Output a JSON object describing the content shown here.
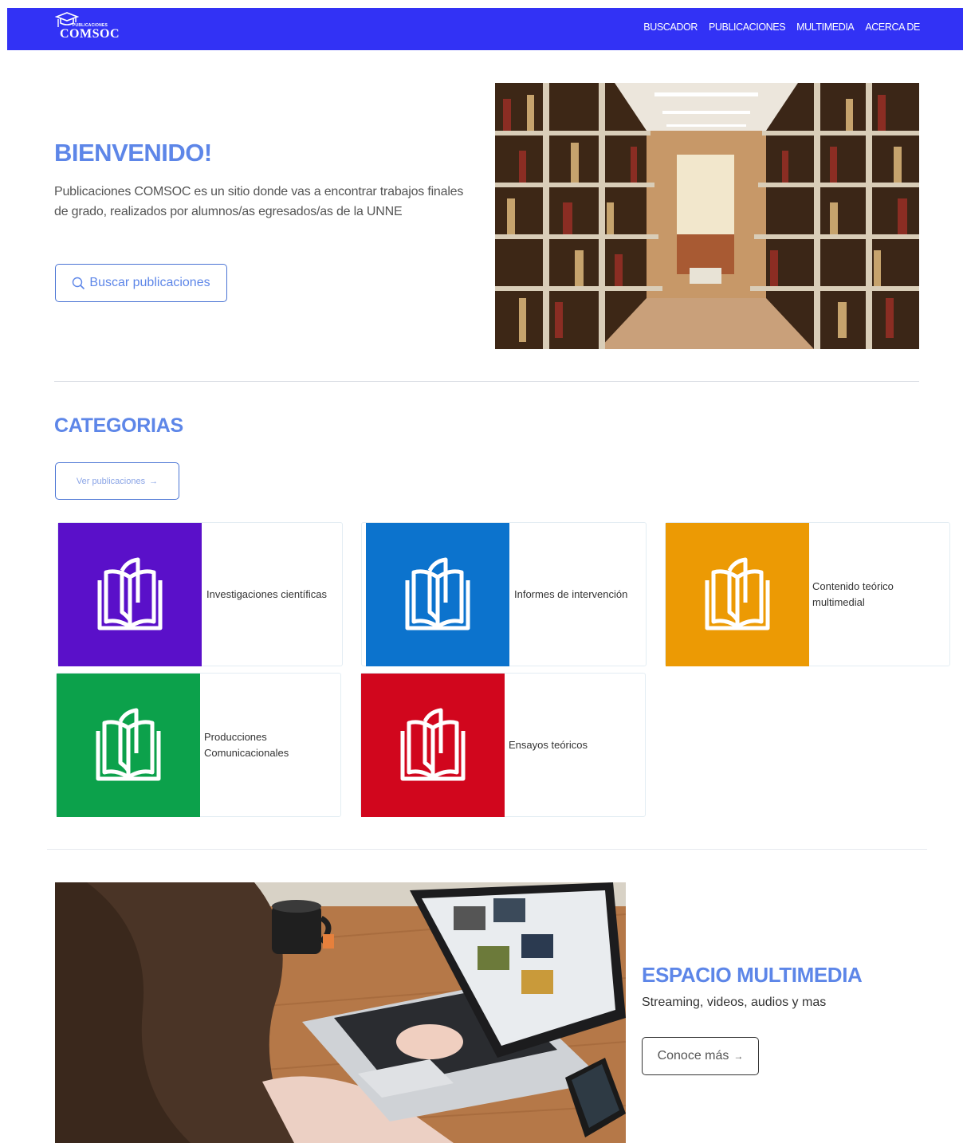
{
  "header": {
    "logo_small": "PUBLICACIONES",
    "logo_big": "COMSOC",
    "nav": [
      "BUSCADOR",
      "PUBLICACIONES",
      "MULTIMEDIA",
      "ACERCA DE"
    ],
    "background": "#3232f5"
  },
  "hero": {
    "title": "BIENVENIDO!",
    "text": "Publicaciones COMSOC es un sitio donde vas a encontrar trabajos finales de grado, realizados por alumnos/as egresados/as de la UNNE",
    "button_label": "Buscar publicaciones",
    "button_icon": "search-icon",
    "image": "library-shelves-photo"
  },
  "categories": {
    "title": "CATEGORIAS",
    "button_label": "Ver publicaciones",
    "button_icon": "arrow-right-icon",
    "items": [
      {
        "label": "Investigaciones científicas",
        "color": "#5a10c9",
        "icon": "book-icon"
      },
      {
        "label": "Informes de intervención",
        "color": "#0c73cd",
        "icon": "book-icon"
      },
      {
        "label": "Contenido teórico multimedial",
        "color": "#ec9a04",
        "icon": "book-icon"
      },
      {
        "label": "Producciones Comunicacionales",
        "color": "#0ca14b",
        "icon": "book-icon"
      },
      {
        "label": "Ensayos teóricos",
        "color": "#d1061d",
        "icon": "book-icon"
      }
    ]
  },
  "multimedia": {
    "title": "ESPACIO MULTIMEDIA",
    "subtitle": "Streaming, videos, audios y mas",
    "button_label": "Conoce más",
    "button_icon": "arrow-right-icon",
    "image": "laptop-desk-photo"
  },
  "colors": {
    "accent": "#5d86e8",
    "button_border": "#4a74d4"
  }
}
